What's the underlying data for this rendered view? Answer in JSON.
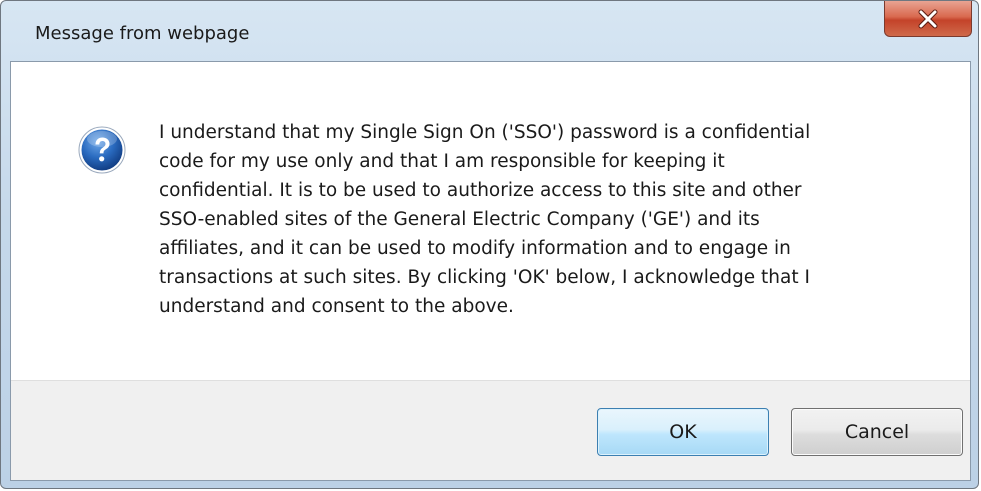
{
  "window": {
    "title": "Message from webpage"
  },
  "icons": {
    "close": "close-icon",
    "question": "question-icon"
  },
  "message": {
    "lines": [
      "I understand that my Single Sign On ('SSO') password is a confidential",
      "code for my use only and that I am responsible for keeping it",
      "confidential.  It is to be used to authorize access to this site and other",
      "SSO-enabled sites of the General Electric Company ('GE') and its",
      "affiliates, and it can be used to modify information and to engage in",
      "transactions at such sites.  By clicking 'OK' below, I acknowledge that I",
      "understand and consent to the above."
    ]
  },
  "buttons": {
    "ok_label": "OK",
    "cancel_label": "Cancel"
  },
  "colors": {
    "close_button": "#c4432a",
    "question_icon": "#1f5fae",
    "ok_border": "#3c7fb1"
  }
}
